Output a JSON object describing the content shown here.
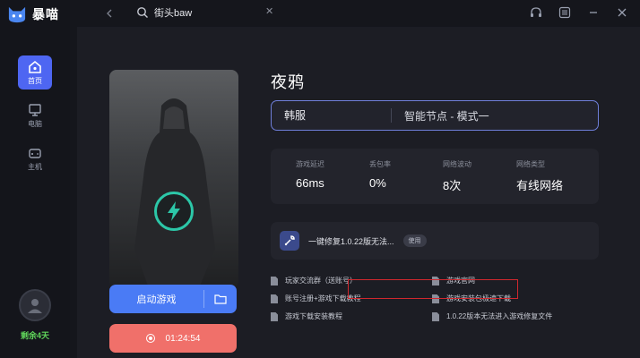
{
  "app": {
    "name": "暴喵"
  },
  "sidebar": {
    "items": [
      {
        "label": "首页",
        "icon": "home-icon",
        "active": true
      },
      {
        "label": "电脑",
        "icon": "monitor-icon",
        "active": false
      },
      {
        "label": "主机",
        "icon": "gamepad-icon",
        "active": false
      }
    ],
    "remaining": "剩余4天"
  },
  "search": {
    "value": "街头baw",
    "placeholder": ""
  },
  "game": {
    "title": "夜鸦",
    "region": "韩服",
    "node_mode": "智能节点 - 模式一"
  },
  "stats": [
    {
      "label": "游戏延迟",
      "value": "66ms"
    },
    {
      "label": "丢包率",
      "value": "0%"
    },
    {
      "label": "网络波动",
      "value": "8次"
    },
    {
      "label": "网络类型",
      "value": "有线网络"
    }
  ],
  "fix": {
    "text": "一键修复1.0.22版无法...",
    "badge": "使用"
  },
  "actions": {
    "start_label": "启动游戏",
    "timer": "01:24:54"
  },
  "links": [
    {
      "text": "玩家交流群（送账号）"
    },
    {
      "text": "账号注册+游戏下载教程"
    },
    {
      "text": "游戏下载安装教程"
    },
    {
      "text": "游戏官网"
    },
    {
      "text": "游戏安装包极速下载"
    },
    {
      "text": "1.0.22版本无法进入游戏修复文件"
    }
  ],
  "colors": {
    "accent": "#4e66f2",
    "start": "#4a7bf5",
    "timer": "#f0706a",
    "remaining": "#5fd35a",
    "highlight": "#d0282e"
  }
}
